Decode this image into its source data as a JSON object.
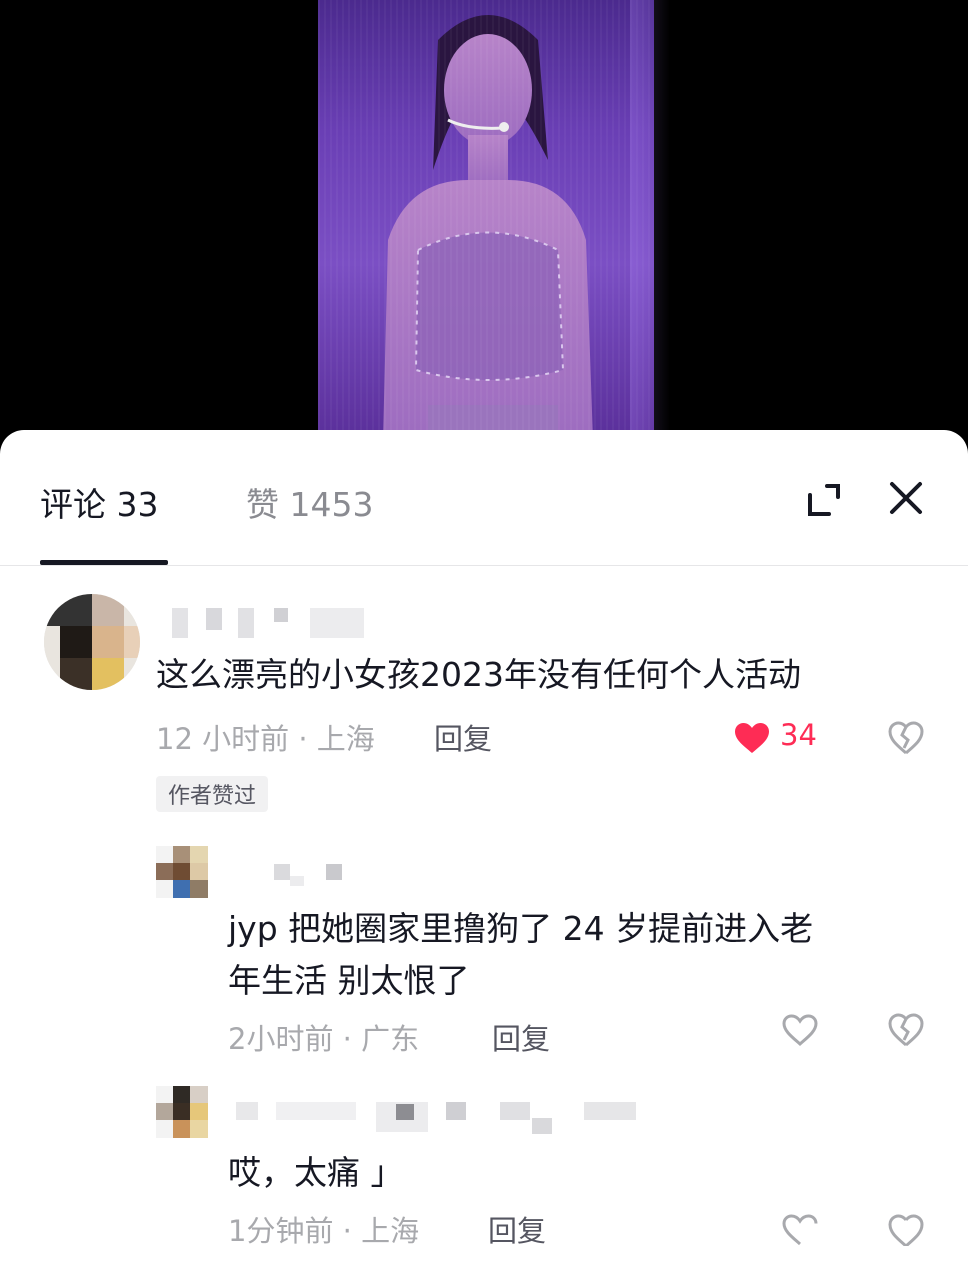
{
  "tabs": [
    {
      "label": "评论 33"
    },
    {
      "label": "赞 1453"
    }
  ],
  "comments": [
    {
      "text": "这么漂亮的小女孩2023年没有任何个人活动",
      "time_location": "12 小时前 · 上海",
      "reply_label": "回复",
      "likes": "34",
      "author_liked_badge": "作者赞过"
    }
  ],
  "replies": [
    {
      "text_line1": "jyp 把她圈家里撸狗了 24 岁提前进入老",
      "text_line2": "年生活 别太恨了",
      "time_location": "2小时前 · 广东",
      "reply_label": "回复"
    },
    {
      "text": "哎，太痛 ｣",
      "time_location": "1分钟前 · 上海",
      "reply_label": "回复"
    }
  ],
  "colors": {
    "like_active": "#fe2c55",
    "text_primary": "#161823",
    "text_secondary": "#a8a9ad"
  }
}
